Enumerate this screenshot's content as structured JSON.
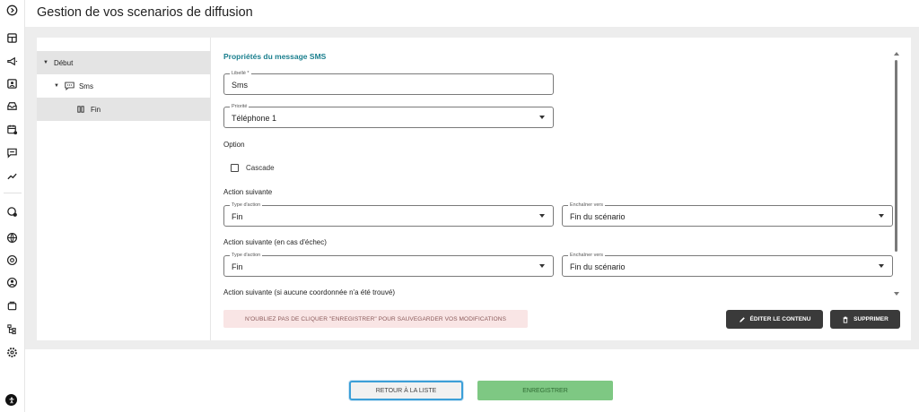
{
  "header": {
    "title": "Gestion de vos scenarios de diffusion"
  },
  "rail": {
    "icons": [
      "chevron-right-circle-icon",
      "dashboard-icon",
      "megaphone-icon",
      "contact-card-icon",
      "inbox-icon",
      "calendar-check-icon",
      "chat-icon",
      "trend-icon",
      "settings-check-icon",
      "globe-icon",
      "at-sign-icon",
      "user-circle-icon",
      "stack-icon",
      "hierarchy-icon",
      "gear-icon"
    ]
  },
  "tree": {
    "items": [
      {
        "label": "Début"
      },
      {
        "label": "Sms"
      },
      {
        "label": "Fin"
      }
    ]
  },
  "props": {
    "title": "Propriétés du message SMS",
    "libelle": {
      "label": "Libellé *",
      "value": "Sms"
    },
    "priorite": {
      "label": "Priorité",
      "value": "Téléphone 1"
    },
    "option_heading": "Option",
    "cascade_label": "Cascade",
    "action1": {
      "heading": "Action suivante",
      "type_label": "Type d'action",
      "type_value": "Fin",
      "target_label": "Enchaîner vers",
      "target_value": "Fin du scénario"
    },
    "action2": {
      "heading": "Action suivante (en cas d'échec)",
      "type_label": "Type d'action",
      "type_value": "Fin",
      "target_label": "Enchaîner vers",
      "target_value": "Fin du scénario"
    },
    "action3": {
      "heading": "Action suivante (si aucune coordonnée n'a été trouvé)"
    },
    "warning": "N'OUBLIEZ PAS DE CLIQUER \"ENREGISTRER\" POUR SAUVEGARDER VOS MODIFICATIONS",
    "edit_label": "ÉDITER LE CONTENU",
    "delete_label": "SUPPRIMER"
  },
  "footer": {
    "back_label": "RETOUR À LA LISTE",
    "save_label": "ENREGISTRER"
  },
  "colors": {
    "accent": "#1a7f8e",
    "save": "#7ec883",
    "focus": "#3b9fd8",
    "warning_bg": "#f9e5e5",
    "dark_button": "#3a3a3a"
  }
}
